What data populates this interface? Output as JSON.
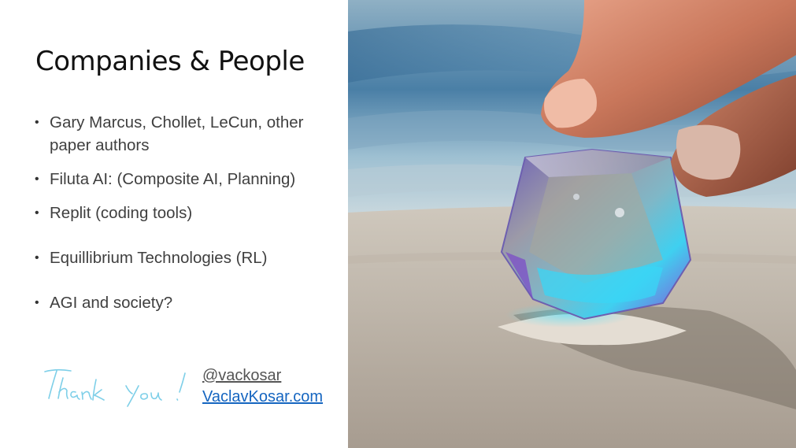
{
  "slide": {
    "title": "Companies & People",
    "bullets": [
      {
        "text": "Gary Marcus, Chollet, LeCun, other paper authors"
      },
      {
        "text": "Filuta AI: (Composite AI, Planning)"
      },
      {
        "text": "Replit (coding tools)"
      },
      {
        "text": "Equillibrium Technologies (RL)"
      },
      {
        "text": "AGI and society?"
      }
    ],
    "signature": "Thank You!",
    "handle": "@vackosar",
    "website": "VaclavKosar.com"
  },
  "colors": {
    "title": "#111111",
    "body_text": "#3f3f3f",
    "link": "#1565c0",
    "signature_ink": "#7ecfe8"
  },
  "icons": {
    "bullet": "bullet-dot-icon",
    "photo": "crystal-in-sand-photo"
  }
}
